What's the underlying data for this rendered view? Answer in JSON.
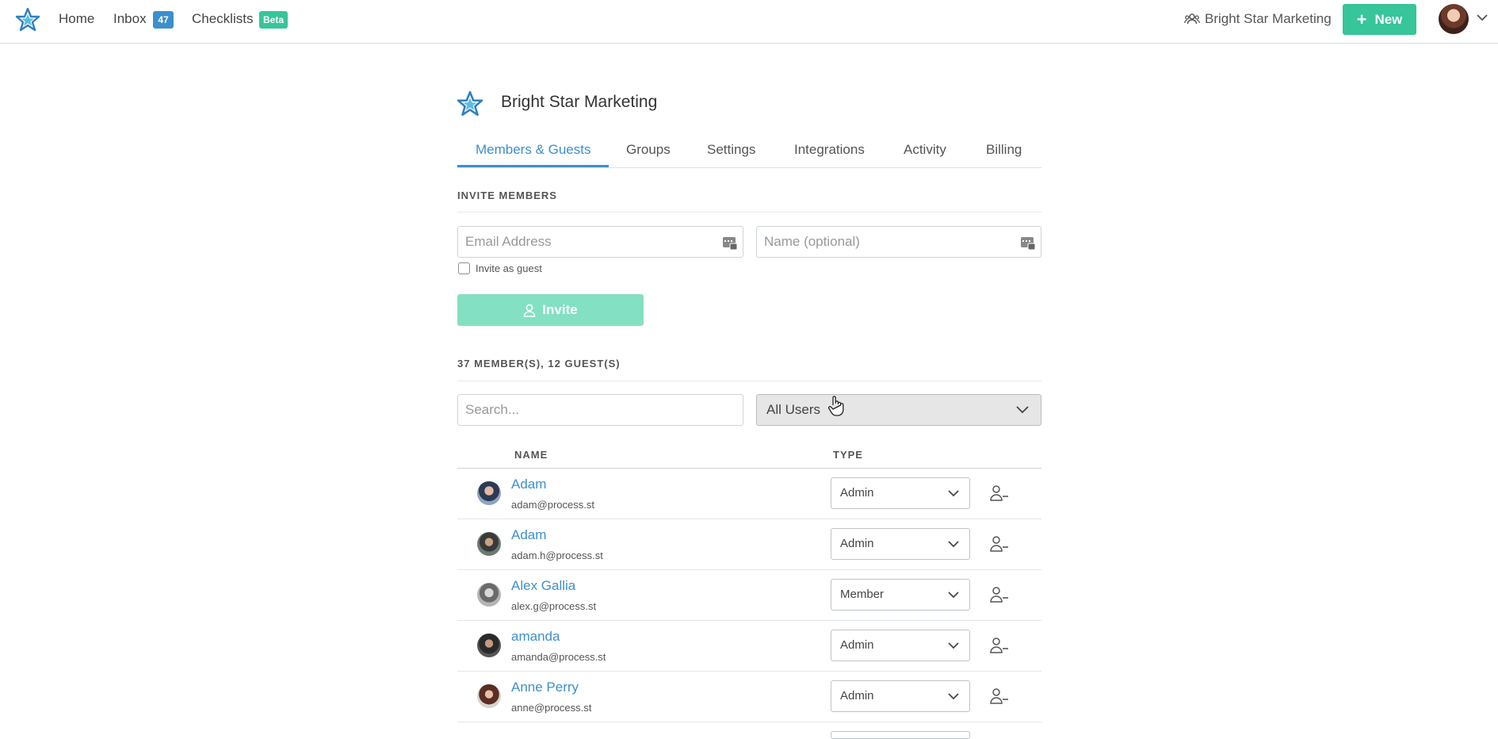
{
  "nav": {
    "home": "Home",
    "inbox": "Inbox",
    "inbox_count": "47",
    "checklists": "Checklists",
    "beta_badge": "Beta",
    "org_name": "Bright Star Marketing",
    "new_button": "New"
  },
  "org": {
    "title": "Bright Star Marketing"
  },
  "tabs": [
    {
      "label": "Members & Guests",
      "active": true
    },
    {
      "label": "Groups"
    },
    {
      "label": "Settings"
    },
    {
      "label": "Integrations"
    },
    {
      "label": "Activity"
    },
    {
      "label": "Billing"
    }
  ],
  "invite": {
    "section_title": "INVITE MEMBERS",
    "email_placeholder": "Email Address",
    "name_placeholder": "Name (optional)",
    "guest_checkbox_label": "Invite as guest",
    "guest_checked": false,
    "button_label": "Invite"
  },
  "members": {
    "summary": "37 MEMBER(S), 12 GUEST(S)",
    "search_placeholder": "Search...",
    "filter_value": "All Users",
    "col_name": "NAME",
    "col_type": "TYPE",
    "rows": [
      {
        "name": "Adam",
        "email": "adam@process.st",
        "type": "Admin"
      },
      {
        "name": "Adam",
        "email": "adam.h@process.st",
        "type": "Admin"
      },
      {
        "name": "Alex Gallia",
        "email": "alex.g@process.st",
        "type": "Member"
      },
      {
        "name": "amanda",
        "email": "amanda@process.st",
        "type": "Admin"
      },
      {
        "name": "Anne Perry",
        "email": "anne@process.st",
        "type": "Admin"
      }
    ]
  },
  "colors": {
    "accent": "#3d8fcc",
    "brand_green": "#37c59a",
    "invite_disabled": "#83e0c3",
    "inbox_badge": "#3d8fcc",
    "beta_badge": "#37c59a"
  },
  "icons": {
    "logo": "star-logo-icon",
    "org": "users-group-icon",
    "remove": "user-minus-icon",
    "caret": "chevron-down-icon",
    "field": "autofill-card-icon"
  }
}
